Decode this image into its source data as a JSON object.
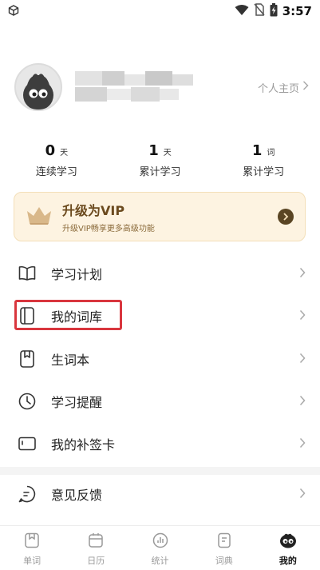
{
  "status_bar": {
    "time": "3:57",
    "icons": [
      "cube-icon",
      "wifi-icon",
      "no-sim-icon",
      "battery-charging-icon"
    ]
  },
  "profile": {
    "homepage_label": "个人主页"
  },
  "stats": [
    {
      "value": "0",
      "unit": "天",
      "label": "连续学习"
    },
    {
      "value": "1",
      "unit": "天",
      "label": "累计学习"
    },
    {
      "value": "1",
      "unit": "词",
      "label": "累计学习"
    }
  ],
  "vip": {
    "title": "升级为VIP",
    "subtitle": "升级VIP畅享更多高级功能"
  },
  "menu": [
    {
      "label": "学习计划",
      "icon": "book-open-icon"
    },
    {
      "label": "我的词库",
      "icon": "notebook-icon"
    },
    {
      "label": "生词本",
      "icon": "bookmark-book-icon"
    },
    {
      "label": "学习提醒",
      "icon": "clock-icon"
    },
    {
      "label": "我的补签卡",
      "icon": "card-icon"
    },
    {
      "label": "意见反馈",
      "icon": "feedback-icon"
    }
  ],
  "tabs": [
    {
      "label": "单词",
      "icon": "word-icon"
    },
    {
      "label": "日历",
      "icon": "calendar-icon"
    },
    {
      "label": "统计",
      "icon": "chart-icon"
    },
    {
      "label": "词典",
      "icon": "dictionary-icon"
    },
    {
      "label": "我的",
      "icon": "mascot-icon",
      "active": true
    }
  ]
}
